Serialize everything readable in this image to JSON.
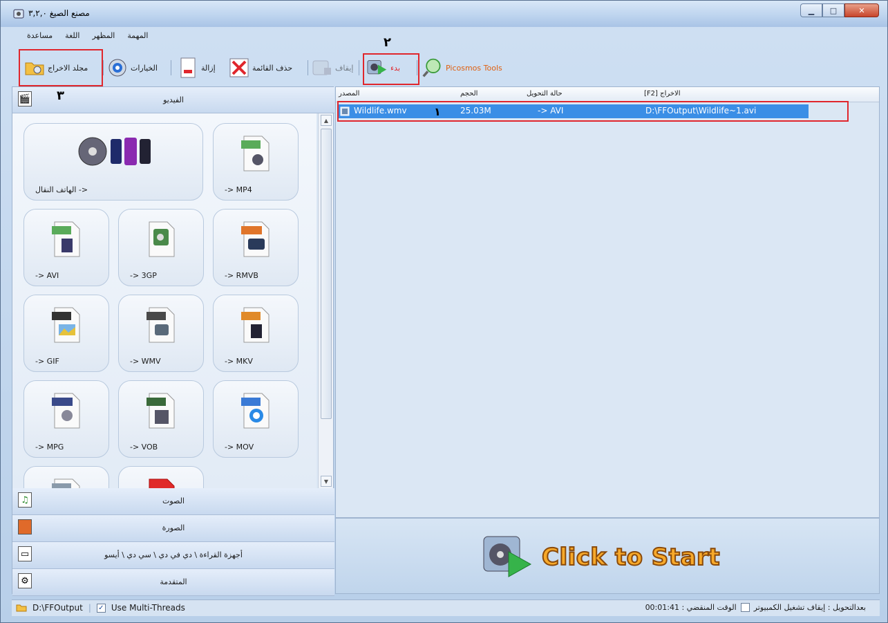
{
  "window": {
    "title": "مصنع الصيغ ٣,٢,٠"
  },
  "menu": [
    "المهمة",
    "المظهر",
    "اللغة",
    "مساعدة"
  ],
  "toolbar": {
    "output_folder": "مجلد الاخراج",
    "options": "الخيارات",
    "remove": "إزالة",
    "clear_list": "حذف القائمة",
    "stop": "إيقاف",
    "start": "بدء",
    "picosmos": "Picosmos Tools"
  },
  "annotations": {
    "one": "١",
    "two": "٢",
    "three": "٣"
  },
  "categories": {
    "video": "الفيديو",
    "audio": "الصوت",
    "picture": "الصورة",
    "rom": "أجهزة القراءة \\ دي في دي \\ سي دي \\ أيسو",
    "advanced": "المتقدمة"
  },
  "tiles": [
    {
      "label": "الهاتف النقال ->",
      "badge": ""
    },
    {
      "label": "-> MP4",
      "badge": "MP4"
    },
    {
      "label": "-> AVI",
      "badge": "AVI"
    },
    {
      "label": "-> 3GP",
      "badge": "3GP"
    },
    {
      "label": "-> RMVB",
      "badge": "RMVB"
    },
    {
      "label": "-> GIF",
      "badge": "GIF"
    },
    {
      "label": "-> WMV",
      "badge": "WMV"
    },
    {
      "label": "-> MKV",
      "badge": "MKV"
    },
    {
      "label": "-> MPG",
      "badge": "MPEG"
    },
    {
      "label": "-> VOB",
      "badge": "VOB"
    },
    {
      "label": "-> MOV",
      "badge": "MOV"
    },
    {
      "label": "",
      "badge": "FLV"
    },
    {
      "label": "",
      "badge": ""
    }
  ],
  "list": {
    "headers": {
      "source": "المصدر",
      "size": "الحجم",
      "status": "حالة التحويل",
      "output": "[F2] الاخراج"
    },
    "rows": [
      {
        "source": "Wildlife.wmv",
        "size": "25.03M",
        "status": "-> AVI",
        "output": "D:\\FFOutput\\Wildlife~1.avi"
      }
    ]
  },
  "start_button": "Click to Start",
  "status": {
    "output_path": "D:\\FFOutput",
    "multi_threads": "Use Multi-Threads",
    "elapsed": "00:01:41 : الوقت المنقضي",
    "after_convert": "بعدالتحويل : إيقاف تشغيل الكمبيوتر"
  },
  "colors": {
    "accent_red": "#e0262c",
    "selection": "#3a8ee6",
    "start_orange": "#f7a92a"
  }
}
